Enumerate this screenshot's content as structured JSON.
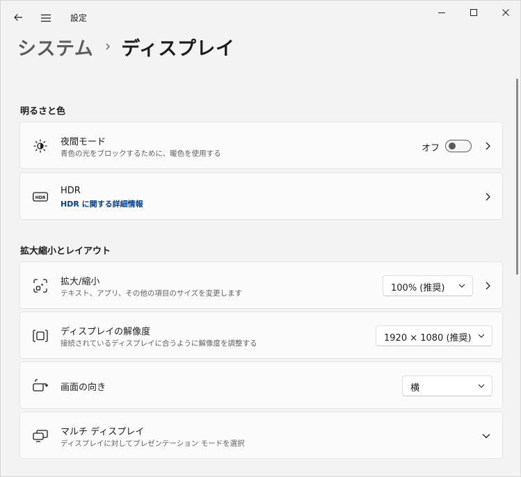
{
  "window": {
    "app_title": "設定",
    "back_icon": "back-arrow-icon",
    "menu_icon": "hamburger-menu-icon",
    "controls": [
      "minimize-icon",
      "maximize-icon",
      "close-icon"
    ]
  },
  "breadcrumb": {
    "parent": "システム",
    "separator_icon": "chevron-right-icon",
    "current": "ディスプレイ"
  },
  "sections": {
    "brightness": {
      "title": "明るさと色",
      "night_mode": {
        "icon": "brightness-sun-icon",
        "title": "夜間モード",
        "subtitle": "青色の光をブロックするために、暖色を使用する",
        "toggle_label": "オフ",
        "toggle_state": false
      },
      "hdr": {
        "icon": "hdr-icon",
        "icon_text": "HDR",
        "title": "HDR",
        "link": "HDR に関する詳細情報"
      }
    },
    "layout": {
      "title": "拡大縮小とレイアウト",
      "scale": {
        "icon": "scale-icon",
        "title": "拡大/縮小",
        "subtitle": "テキスト、アプリ、その他の項目のサイズを変更します",
        "value": "100% (推奨)"
      },
      "resolution": {
        "icon": "resolution-icon",
        "title": "ディスプレイの解像度",
        "subtitle": "接続されているディスプレイに合うように解像度を調整する",
        "value": "1920 × 1080 (推奨)"
      },
      "orientation": {
        "icon": "orientation-icon",
        "title": "画面の向き",
        "value": "横"
      },
      "multi_display": {
        "icon": "multi-display-icon",
        "title": "マルチ ディスプレイ",
        "subtitle": "ディスプレイに対してプレゼンテーション モードを選択"
      }
    }
  },
  "colors": {
    "background": "#f3f3f3",
    "card": "#fbfbfb",
    "link": "#003e92"
  }
}
